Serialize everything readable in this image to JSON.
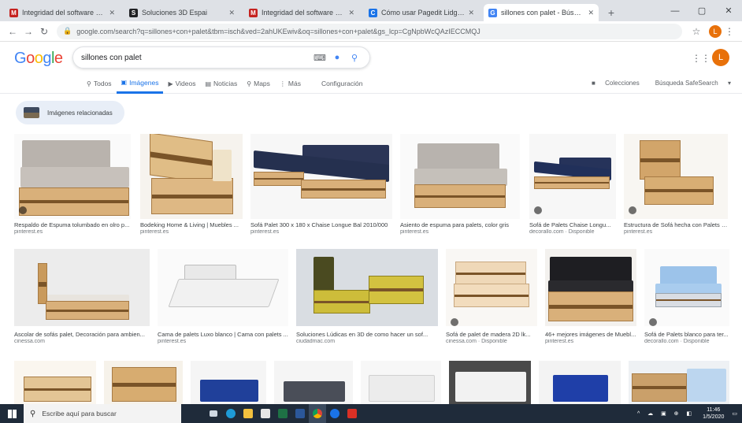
{
  "browser": {
    "tabs": [
      {
        "title": "Integridad del software original",
        "favicon_color": "#c5221f",
        "favicon_letter": "M",
        "active": false
      },
      {
        "title": "Soluciones 3D Espai",
        "favicon_color": "#202124",
        "favicon_letter": "S",
        "active": false
      },
      {
        "title": "Integridad del software original",
        "favicon_color": "#c5221f",
        "favicon_letter": "M",
        "active": false
      },
      {
        "title": "Cómo usar Pagedit Lidgap",
        "favicon_color": "#1a73e8",
        "favicon_letter": "C",
        "active": false
      },
      {
        "title": "sillones con palet - Búsqueda",
        "favicon_color": "#4285f4",
        "favicon_letter": "G",
        "active": true
      }
    ],
    "new_tab_symbol": "+",
    "url": "google.com/search?q=sillones+con+palet&tbm=isch&ved=2ahUKEwiv&oq=sillones+con+palet&gs_lcp=CgNpbWcQAzIECCMQJ",
    "profile_letter": "L"
  },
  "google": {
    "logo": "Google",
    "query": "sillones con palet",
    "avatar_letter": "L",
    "tabs": [
      {
        "label": "Todos",
        "icon": "search-icon",
        "active": false
      },
      {
        "label": "Imágenes",
        "icon": "image-icon",
        "active": true
      },
      {
        "label": "Videos",
        "icon": "video-icon",
        "active": false
      },
      {
        "label": "Noticias",
        "icon": "news-icon",
        "active": false
      },
      {
        "label": "Maps",
        "icon": "map-pin-icon",
        "active": false
      },
      {
        "label": "Más",
        "icon": "more-icon",
        "active": false
      },
      {
        "label": "Configuración",
        "icon": "",
        "active": false
      }
    ],
    "right_tools": [
      "Colecciones",
      "Búsqueda SafeSearch"
    ],
    "related_chip": "Imágenes relacionadas"
  },
  "results": {
    "row1": [
      {
        "caption": "Respaldo de Espuma tolumbado en olro p...",
        "source": "pinterest.es"
      },
      {
        "caption": "Bodeking Home & Living | Muebles ...",
        "source": "pinterest.es"
      },
      {
        "caption": "Sofá Palet 300 x 180 x Chaise Longue Bal 2010/000",
        "source": "pinterest.es"
      },
      {
        "caption": "Asiento de espuma para palets, color gris",
        "source": "pinterest.es"
      },
      {
        "caption": "Sofá de Palets Chaise Longu...",
        "source": "decorallo.com · Disponible"
      },
      {
        "caption": "Estructura de Sofá hecha con Palets Pi...",
        "source": "pinterest.es"
      }
    ],
    "row2": [
      {
        "caption": "Ascolar de sofás palet, Decoración para ambien...",
        "source": "cinessa.com"
      },
      {
        "caption": "Cama de palets Luxo blanco | Cama con palets ...",
        "source": "pinterest.es"
      },
      {
        "caption": "Soluciones Lúdicas en 3D de como hacer un sof...",
        "source": "ciudadmac.com"
      },
      {
        "caption": "Sofá de palet de madera 2D lk...",
        "source": "cinessa.com · Disponible"
      },
      {
        "caption": "46+ mejores imágenes de Muebl...",
        "source": "pinterest.es"
      },
      {
        "caption": "Sofá de Palets blanco para ter...",
        "source": "decorallo.com · Disponible"
      }
    ]
  },
  "taskbar": {
    "search_placeholder": "Escribe aquí para buscar",
    "time": "11:46",
    "date": "1/5/2020",
    "tray_icons": "^ ☁ ▣ ⊕ ◧"
  },
  "colors": {
    "accent": "#1a73e8",
    "google_blue": "#4285f4",
    "google_red": "#ea4335",
    "google_yellow": "#fbbc05",
    "google_green": "#34a853",
    "avatar": "#e8710a"
  }
}
